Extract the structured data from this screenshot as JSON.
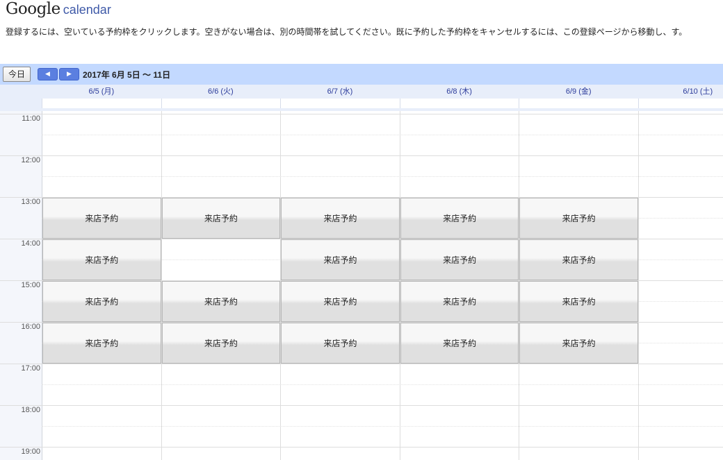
{
  "logo": {
    "google": "Google",
    "calendar": "calendar"
  },
  "instructions": "登録するには、空いている予約枠をクリックします。空きがない場合は、別の時間帯を試してください。既に予約した予約枠をキャンセルするには、この登録ページから移動し、す。",
  "toolbar": {
    "today_label": "今日",
    "prev_icon": "◀",
    "next_icon": "▶",
    "date_range": "2017年 6月 5日 ～ 11日"
  },
  "days": [
    "6/5 (月)",
    "6/6 (火)",
    "6/7 (水)",
    "6/8 (木)",
    "6/9 (金)",
    "6/10 (土)"
  ],
  "times": [
    "11:00",
    "12:00",
    "13:00",
    "14:00",
    "15:00",
    "16:00",
    "17:00",
    "18:00",
    "19:00"
  ],
  "slot_label": "来店予約",
  "slots": [
    {
      "day": 0,
      "start": "13:00"
    },
    {
      "day": 1,
      "start": "13:00"
    },
    {
      "day": 2,
      "start": "13:00"
    },
    {
      "day": 3,
      "start": "13:00"
    },
    {
      "day": 4,
      "start": "13:00"
    },
    {
      "day": 0,
      "start": "14:00"
    },
    {
      "day": 2,
      "start": "14:00"
    },
    {
      "day": 3,
      "start": "14:00"
    },
    {
      "day": 4,
      "start": "14:00"
    },
    {
      "day": 0,
      "start": "15:00"
    },
    {
      "day": 1,
      "start": "15:00"
    },
    {
      "day": 2,
      "start": "15:00"
    },
    {
      "day": 3,
      "start": "15:00"
    },
    {
      "day": 4,
      "start": "15:00"
    },
    {
      "day": 0,
      "start": "16:00"
    },
    {
      "day": 1,
      "start": "16:00"
    },
    {
      "day": 2,
      "start": "16:00"
    },
    {
      "day": 3,
      "start": "16:00"
    },
    {
      "day": 4,
      "start": "16:00"
    }
  ]
}
